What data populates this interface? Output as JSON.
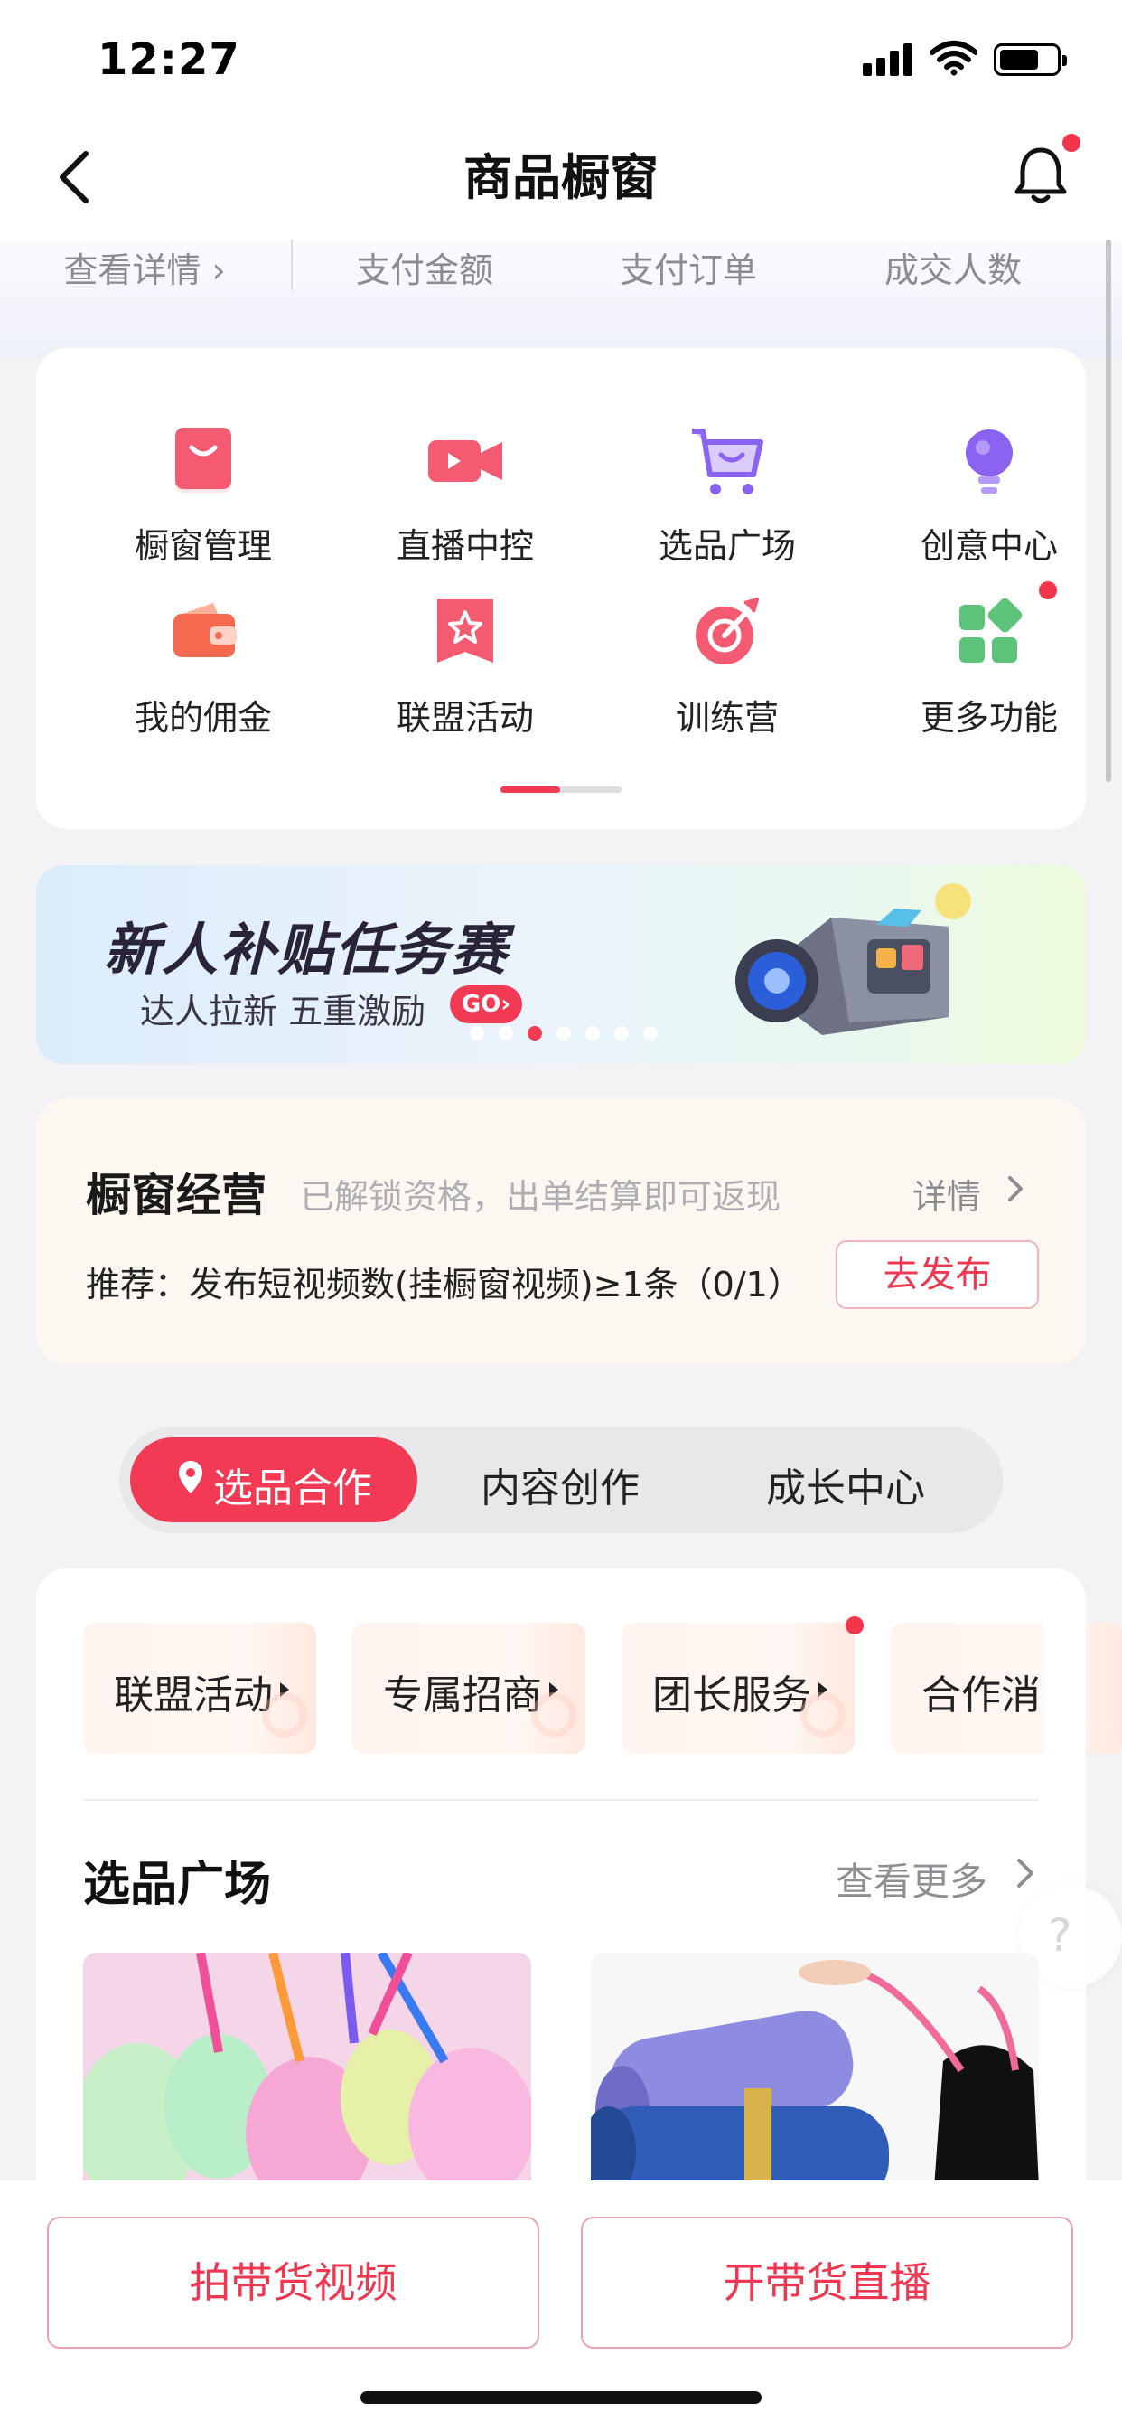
{
  "status_bar": {
    "time": "12:27"
  },
  "nav": {
    "title": "商品橱窗"
  },
  "stats": {
    "view_details": "查看详情 ›",
    "pay_amount": "支付金额",
    "pay_orders": "支付订单",
    "buyers": "成交人数"
  },
  "grid": {
    "items": [
      {
        "label": "橱窗管理",
        "icon": "shopping-bag-icon"
      },
      {
        "label": "直播中控",
        "icon": "video-camera-icon"
      },
      {
        "label": "选品广场",
        "icon": "shopping-cart-icon"
      },
      {
        "label": "创意中心",
        "icon": "lightbulb-icon"
      },
      {
        "label": "我的佣金",
        "icon": "wallet-icon"
      },
      {
        "label": "联盟活动",
        "icon": "star-badge-icon"
      },
      {
        "label": "训练营",
        "icon": "target-icon"
      },
      {
        "label": "更多功能",
        "icon": "apps-grid-icon"
      }
    ]
  },
  "banner": {
    "title": "新人补贴任务赛",
    "subtitle": "达人拉新 五重激励",
    "go": "GO›"
  },
  "operation": {
    "title": "橱窗经营",
    "subtitle": "已解锁资格，出单结算即可返现",
    "detail": "详情",
    "recommendation": "推荐：发布短视频数(挂橱窗视频)≥1条（0/1）",
    "publish_button": "去发布"
  },
  "segments": {
    "tabs": [
      "选品合作",
      "内容创作",
      "成长中心"
    ],
    "active": "选品合作"
  },
  "chips": [
    {
      "label": "联盟活动"
    },
    {
      "label": "专属招商"
    },
    {
      "label": "团长服务"
    },
    {
      "label": "合作消"
    }
  ],
  "section": {
    "title": "选品广场",
    "more": "查看更多"
  },
  "help": {
    "label": "?"
  },
  "bottom": {
    "video_button": "拍带货视频",
    "live_button": "开带货直播"
  },
  "colors": {
    "accent": "#f23a55",
    "background": "#f3f3f5"
  }
}
